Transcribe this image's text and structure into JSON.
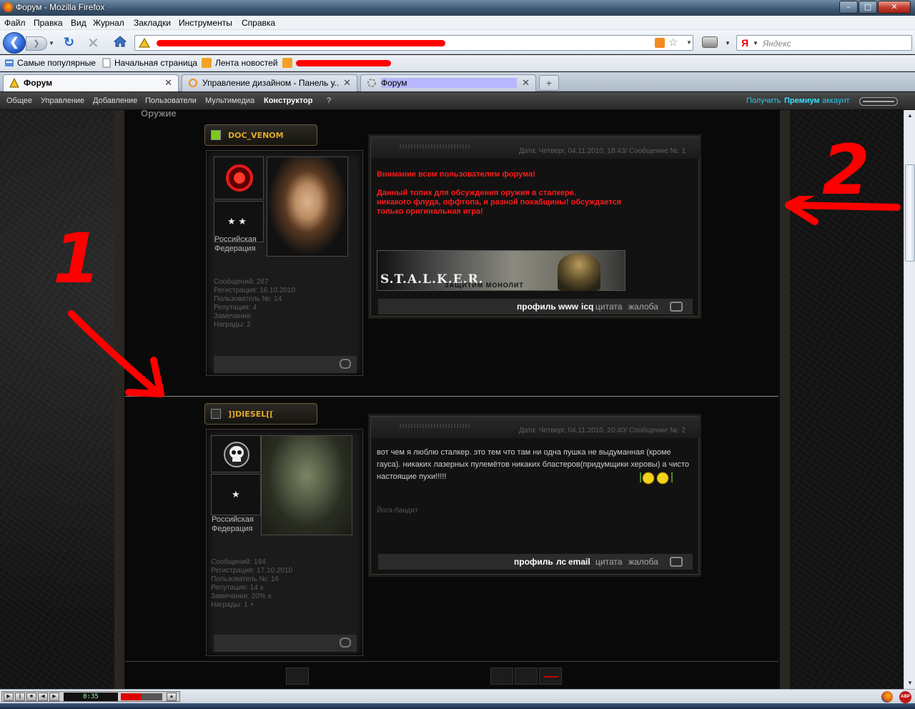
{
  "window": {
    "title": "Форум - Mozilla Firefox",
    "min": "–",
    "max": "□",
    "close": "✕"
  },
  "menu": [
    "Файл",
    "Правка",
    "Вид",
    "Журнал",
    "Закладки",
    "Инструменты",
    "Справка"
  ],
  "navbar": {
    "back_icon": "back-arrow-icon",
    "search_engine_badge": "Я",
    "search_placeholder": "Яндекс"
  },
  "bookmarks": [
    "Самые популярные",
    "Начальная страница",
    "Лента новостей"
  ],
  "tabs": [
    {
      "label": "Форум",
      "active": true
    },
    {
      "label": "Управление дизайном - Панель у...",
      "active": false
    },
    {
      "label": "Форум",
      "active": false
    }
  ],
  "new_tab_label": "+",
  "adminbar": {
    "items": [
      "Общее",
      "Управление",
      "Добавление",
      "Пользователи",
      "Мультимедиа",
      "Конструктор",
      "?"
    ],
    "premium_prefix": "Получить",
    "premium_bold": "Премиум",
    "premium_suffix": "аккаунт"
  },
  "forum": {
    "section_title": "Оружие"
  },
  "posts": [
    {
      "nick": "DOC_VENOM",
      "rank_stars": "★ ★",
      "country": "Российская Федерация",
      "stats": [
        "Сообщений: 267",
        "Регистрация: 16.10.2010",
        "Пользователь №: 14",
        "Репутация: 4",
        "Замечания:",
        "Награды: 2"
      ],
      "header": "Дата: Четверг, 04.11.2010, 18:43/ Сообщение №: 1",
      "body_red": [
        "Внимание всем пользователям форума!",
        "",
        "Данный топик для обсуждения оружия в сталкере.",
        "никакого флуда, оффтопа, и разной похабщины! обсуждается",
        "только оригинальная игра!"
      ],
      "banner": {
        "logo": "S.T.A.L.K.E.R.",
        "caption": "ЗАЩИТИМ МОНОЛИТ"
      },
      "actions": [
        "профиль",
        "www",
        "icq"
      ],
      "actions_plain": [
        "цитата",
        "жалоба"
      ]
    },
    {
      "nick": "]]DIESEL[[",
      "rank_stars": "★",
      "country": "Российская Федерация",
      "stats": [
        "Сообщений: 194",
        "Регистрация: 17.10.2010",
        "Пользователь №: 16",
        "Репутация: 14 ±",
        "Замечания: 20% ±",
        "Награды: 1 +"
      ],
      "header": "Дата: Четверг, 04.11.2010, 20:40/ Сообщение №: 2",
      "body": "вот чем я люблю сталкер. это тем что там ни одна пушка не выдуманная (кроме гауса). никаких лазерных пулемётов никаких бластеров(придумщики херовы) а чисто настоящие пухи!!!!!",
      "signature": "Йога-бандит",
      "actions": [
        "профиль",
        "лс",
        "email"
      ],
      "actions_plain": [
        "цитата",
        "жалоба"
      ]
    }
  ],
  "player": {
    "time": "0:35"
  },
  "statusbar": {
    "abp_label": "ABP"
  },
  "annotations": [
    "1",
    "2"
  ],
  "colors": {
    "accent_red": "#ff0000",
    "nick_gold": "#e0a92a",
    "premium_cyan": "#35e0ff"
  }
}
